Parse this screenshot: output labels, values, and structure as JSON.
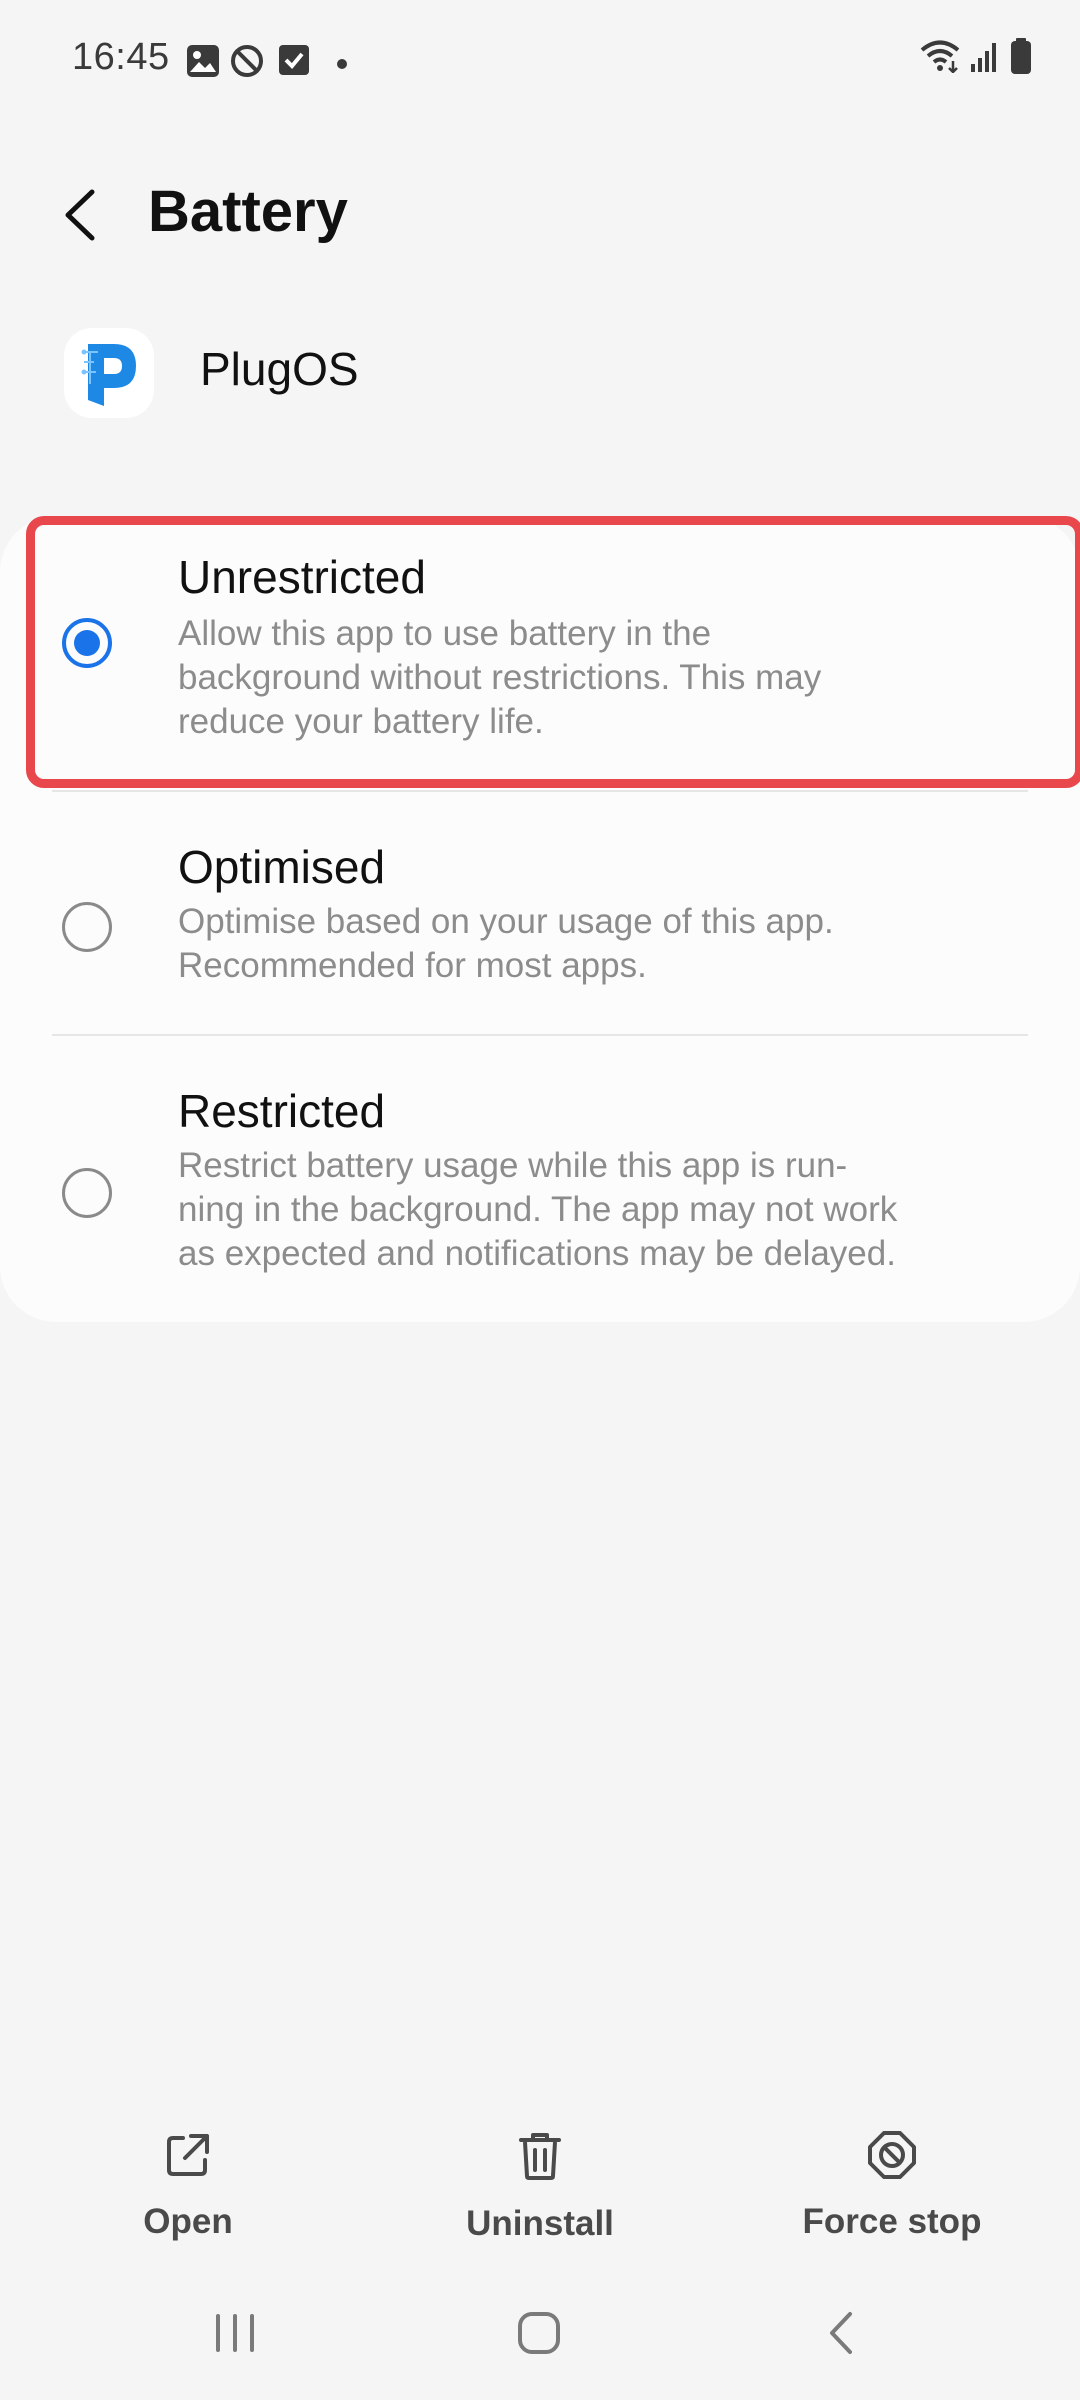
{
  "status_bar": {
    "time": "16:45",
    "icons_left": [
      "gallery-icon",
      "data-saver-off-icon",
      "checkbox-icon",
      "dot-icon"
    ],
    "icons_right": [
      "wifi-icon",
      "signal-icon",
      "battery-icon"
    ]
  },
  "header": {
    "title": "Battery",
    "back_icon": "chevron-left-icon"
  },
  "app": {
    "name": "PlugOS",
    "icon": "plugos-app-icon",
    "brand_color": "#1e88e5"
  },
  "options": [
    {
      "title": "Unrestricted",
      "description_lines": [
        "Allow this app to use battery in the",
        "background without restrictions. This may",
        "reduce your battery life."
      ],
      "selected": true
    },
    {
      "title": "Optimised",
      "description_lines": [
        "Optimise based on your usage of this app.",
        "Recommended for most apps."
      ],
      "selected": false
    },
    {
      "title": "Restricted",
      "description_lines": [
        "Restrict battery usage while this app is run-",
        "ning in the background. The app may not work",
        "as expected and notifications may be delayed."
      ],
      "selected": false
    }
  ],
  "actions": [
    {
      "label": "Open",
      "icon": "open-external-icon"
    },
    {
      "label": "Uninstall",
      "icon": "trash-icon"
    },
    {
      "label": "Force stop",
      "icon": "force-stop-icon"
    }
  ],
  "nav_bar": {
    "icons": [
      "recents-icon",
      "home-icon",
      "back-icon"
    ]
  },
  "colors": {
    "accent": "#1a73e8",
    "highlight_border": "#e8474b",
    "background": "#f5f5f5",
    "card": "#fcfcfc",
    "secondary_text": "#8c8c8c"
  }
}
